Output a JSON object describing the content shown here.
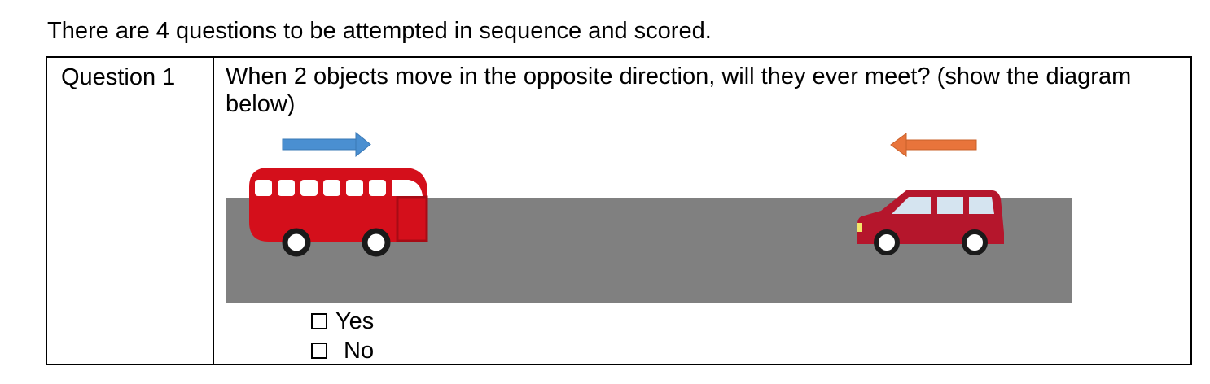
{
  "intro_text": "There are 4 questions to be attempted in sequence and scored.",
  "question": {
    "label": "Question 1",
    "text": "When 2 objects move in the opposite direction, will they ever meet? (show the diagram below)",
    "options": [
      {
        "label": "Yes"
      },
      {
        "label": "No"
      }
    ]
  },
  "diagram": {
    "left_arrow_direction": "right",
    "right_arrow_direction": "left",
    "colors": {
      "road": "#808080",
      "bus": "#d40f1b",
      "car": "#b5162c",
      "car_windows": "#d5e4f0",
      "arrow_right": "#4a8fd1",
      "arrow_left": "#e8743b"
    },
    "icons": [
      "bus-icon",
      "car-icon",
      "arrow-right-icon",
      "arrow-left-icon"
    ]
  }
}
